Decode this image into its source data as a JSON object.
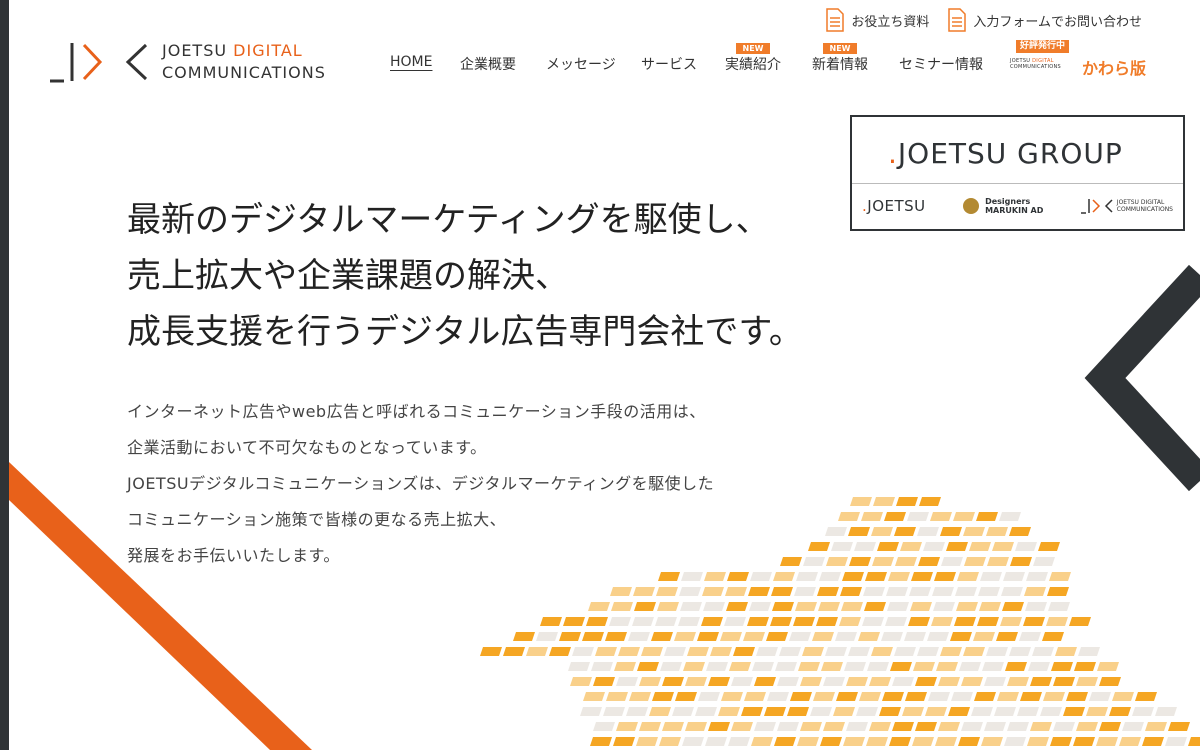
{
  "header": {
    "logo": {
      "line1_a": "JOETSU",
      "line1_b": "DIGITAL",
      "line2": "COMMUNICATIONS"
    },
    "util_links": [
      {
        "label": "お役立ち資料",
        "icon": "document-icon"
      },
      {
        "label": "入力フォームでお問い合わせ",
        "icon": "document-icon"
      }
    ],
    "nav": [
      {
        "label": "HOME",
        "active": true
      },
      {
        "label": "企業概要"
      },
      {
        "label": "メッセージ"
      },
      {
        "label": "サービス"
      },
      {
        "label": "実績紹介",
        "badge": "NEW"
      },
      {
        "label": "新着情報",
        "badge": "NEW"
      },
      {
        "label": "セミナー情報"
      }
    ],
    "kawara": {
      "badge": "好評発行中",
      "small1a": "JOETSU",
      "small1b": "DIGITAL",
      "small2": "COMMUNICATIONS",
      "main": "かわら版"
    }
  },
  "group_banner": {
    "title": "JOETSU GROUP",
    "logos": {
      "joetsu": "JOETSU",
      "marukin_top": "Designers",
      "marukin_bottom": "MARUKIN AD",
      "jdc_line1": "JOETSU DIGITAL",
      "jdc_line2": "COMMUNICATIONS"
    }
  },
  "hero": {
    "headline": [
      "最新のデジタルマーケティングを駆使し、",
      "売上拡大や企業課題の解決、",
      "成長支援を行うデジタル広告専門会社です。"
    ],
    "body": [
      "インターネット広告やweb広告と呼ばれるコミュニケーション手段の活用は、",
      "企業活動において不可欠なものとなっています。",
      "JOETSUデジタルコミュニケーションズは、デジタルマーケティングを駆使した",
      "コミュニケーション施策で皆様の更なる売上拡大、",
      "発展をお手伝いいたします。"
    ]
  },
  "colors": {
    "accent_orange": "#e8611a",
    "dark": "#2f3336",
    "tile_orange": "#f5a623",
    "tile_light": "#f9d08a",
    "tile_gray": "#ece8e3"
  }
}
